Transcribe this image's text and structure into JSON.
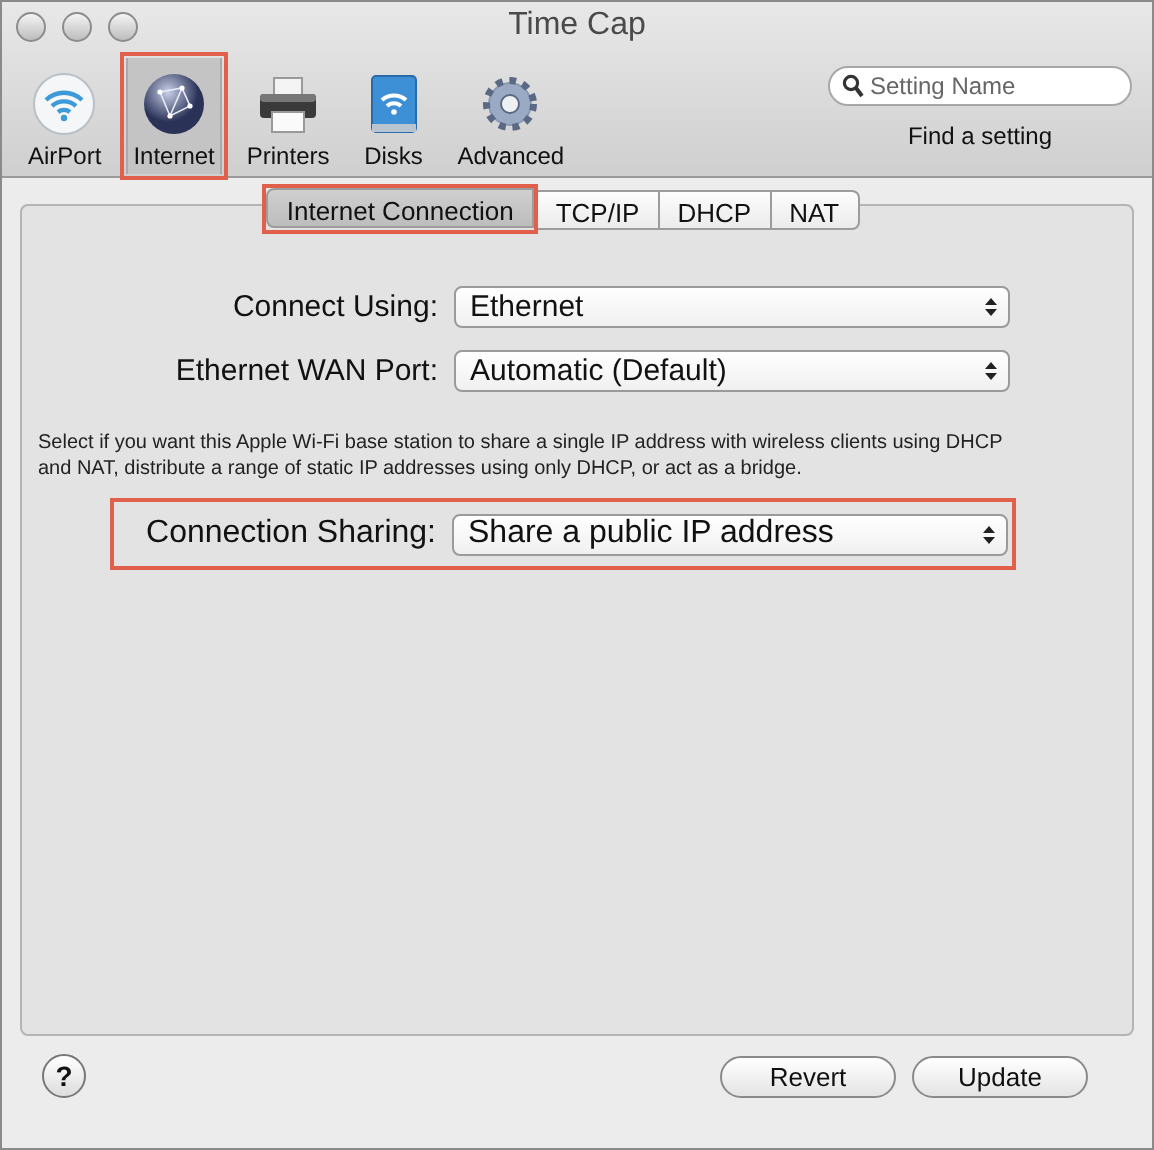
{
  "window": {
    "title": "Time Cap"
  },
  "toolbar": [
    {
      "label": "AirPort",
      "kind": "wifi",
      "selected": false,
      "highlighted": false
    },
    {
      "label": "Internet",
      "kind": "globe",
      "selected": true,
      "highlighted": true
    },
    {
      "label": "Printers",
      "kind": "printer",
      "selected": false,
      "highlighted": false
    },
    {
      "label": "Disks",
      "kind": "disk",
      "selected": false,
      "highlighted": false
    },
    {
      "label": "Advanced",
      "kind": "gear",
      "selected": false,
      "highlighted": false
    }
  ],
  "search": {
    "placeholder": "Setting Name",
    "caption": "Find a setting"
  },
  "tabs": [
    {
      "label": "Internet Connection",
      "selected": true,
      "highlighted": true
    },
    {
      "label": "TCP/IP",
      "selected": false,
      "highlighted": false
    },
    {
      "label": "DHCP",
      "selected": false,
      "highlighted": false
    },
    {
      "label": "NAT",
      "selected": false,
      "highlighted": false
    }
  ],
  "rows": [
    {
      "kind": "popup",
      "label": "Connect Using:",
      "value": "Ethernet",
      "highlighted": false
    },
    {
      "kind": "popup",
      "label": "Ethernet WAN Port:",
      "value": "Automatic (Default)",
      "highlighted": false
    },
    {
      "kind": "note",
      "text": "Select if you want this Apple Wi-Fi base station to share a single IP address with wireless clients using DHCP and NAT, distribute a range of static IP addresses using only DHCP, or act as a bridge."
    },
    {
      "kind": "popup",
      "label": "Connection Sharing:",
      "value": "Share a public IP address",
      "highlighted": true
    }
  ],
  "footer": {
    "help": "?",
    "buttons": [
      "Revert",
      "Update"
    ]
  }
}
